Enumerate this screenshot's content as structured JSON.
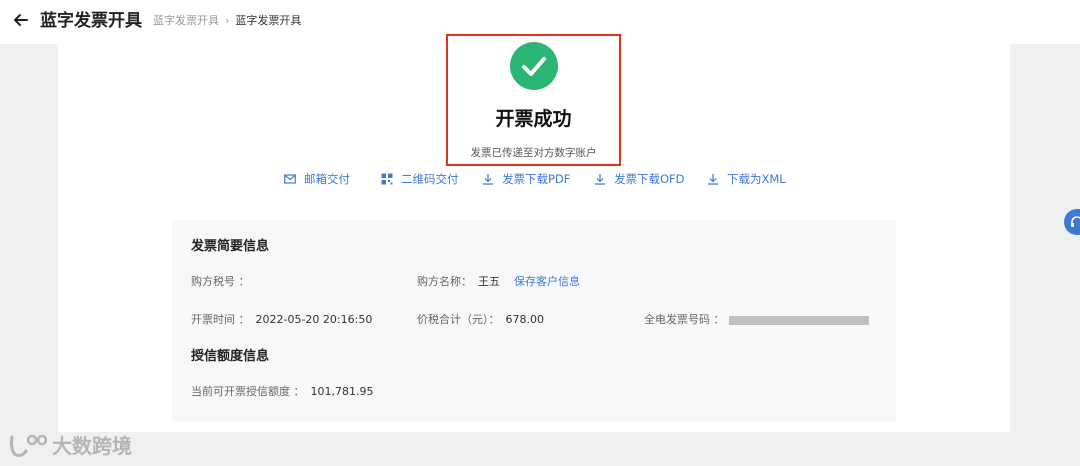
{
  "header": {
    "title": "蓝字发票开具",
    "breadcrumb": [
      "蓝字发票开具",
      "蓝字发票开具"
    ]
  },
  "result": {
    "title": "开票成功",
    "subtitle": "发票已传递至对方数字账户"
  },
  "actions": [
    {
      "label": "邮箱交付",
      "icon": "mail-icon"
    },
    {
      "label": "二维码交付",
      "icon": "qrcode-icon"
    },
    {
      "label": "发票下载PDF",
      "icon": "download-icon"
    },
    {
      "label": "发票下载OFD",
      "icon": "download-icon"
    },
    {
      "label": "下载为XML",
      "icon": "download-icon"
    }
  ],
  "summary": {
    "title": "发票简要信息",
    "buyer_tax_no_label": "购方税号 ：",
    "buyer_tax_no_value": "",
    "buyer_name_label": "购方名称：",
    "buyer_name_value": "王五",
    "save_customer_link": "保存客户信息",
    "issue_time_label": "开票时间 ：",
    "issue_time_value": "2022-05-20 20:16:50",
    "total_label": "价税合计（元）：",
    "total_value": "678.00",
    "invoice_no_label": "全电发票号码 ："
  },
  "credit": {
    "title": "授信额度信息",
    "available_label": "当前可开票授信额度 ：",
    "available_value": "101,781.95"
  },
  "watermark": {
    "text": "大数跨境"
  },
  "colors": {
    "accent": "#3d7ad6",
    "success": "#2bb673",
    "highlight": "#e0301e"
  }
}
